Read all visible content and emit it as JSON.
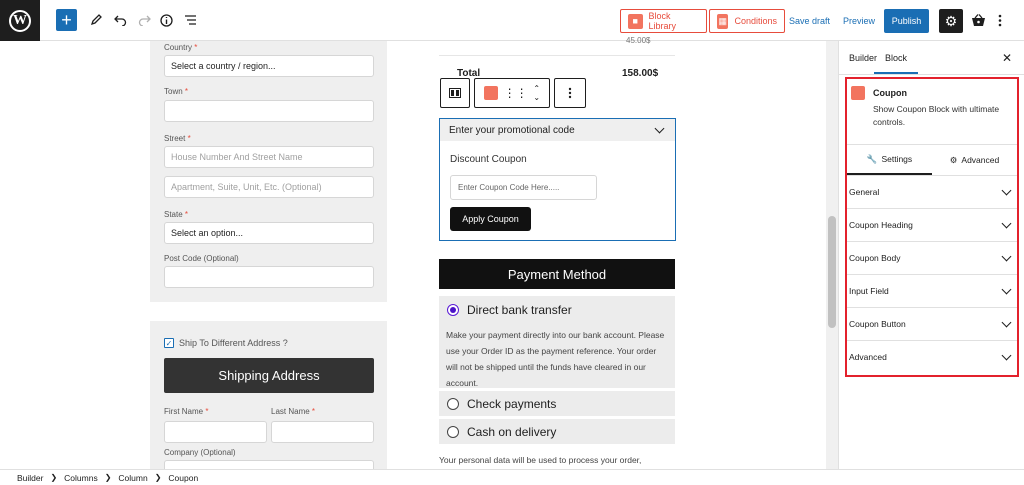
{
  "toolbar": {
    "block_library": "Block Library",
    "conditions": "Conditions",
    "save_draft": "Save draft",
    "preview": "Preview",
    "publish": "Publish"
  },
  "checkout": {
    "country_label": "Country",
    "country_value": "Select a country / region...",
    "town_label": "Town",
    "street_label": "Street",
    "street_placeholder": "House Number And Street Name",
    "street2_placeholder": "Apartment, Suite, Unit, Etc. (Optional)",
    "state_label": "State",
    "state_value": "Select an option...",
    "postcode_label": "Post Code (Optional)",
    "ship_different": "Ship To Different Address ?",
    "shipping_title": "Shipping Address",
    "first_name_label": "First Name",
    "last_name_label": "Last Name",
    "company_label": "Company (Optional)",
    "required_mark": "*"
  },
  "order": {
    "partial_amount": "45.00$",
    "total_label": "Total",
    "total_value": "158.00$"
  },
  "coupon": {
    "heading": "Enter your promotional code",
    "title": "Discount Coupon",
    "placeholder": "Enter Coupon Code Here.....",
    "apply": "Apply Coupon"
  },
  "payment": {
    "heading": "Payment Method",
    "options": [
      "Direct bank transfer",
      "Check payments",
      "Cash on delivery"
    ],
    "selected": "Direct bank transfer",
    "description": "Make your payment directly into our bank account. Please use your Order ID as the payment reference. Your order will not be shipped until the funds have cleared in our account.",
    "privacy": "Your personal data will be used to process your order,"
  },
  "sidebar": {
    "tabs": [
      "Builder",
      "Block"
    ],
    "active_tab": "Block",
    "block_name": "Coupon",
    "block_desc": "Show Coupon Block with ultimate controls.",
    "subtabs": [
      "Settings",
      "Advanced"
    ],
    "panels": [
      "General",
      "Coupon Heading",
      "Coupon Body",
      "Input Field",
      "Coupon Button",
      "Advanced"
    ]
  },
  "breadcrumb": [
    "Builder",
    "Columns",
    "Column",
    "Coupon"
  ],
  "colors": {
    "accent": "#1a6eb4",
    "highlight": "#e3212c",
    "brand_orange": "#f2745f"
  }
}
